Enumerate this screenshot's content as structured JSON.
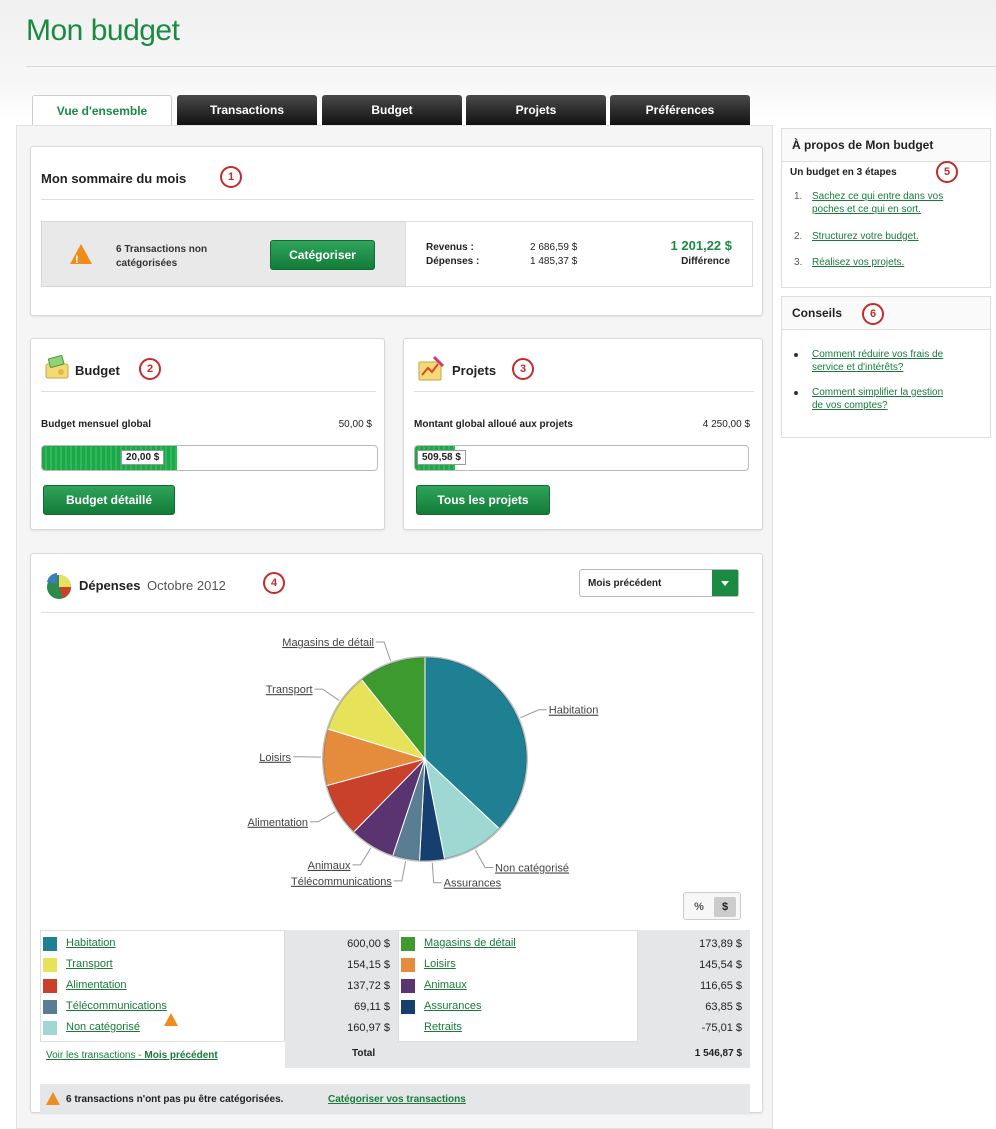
{
  "page": {
    "title": "Mon budget"
  },
  "tabs": [
    {
      "label": "Vue d'ensemble",
      "active": true
    },
    {
      "label": "Transactions",
      "active": false
    },
    {
      "label": "Budget",
      "active": false
    },
    {
      "label": "Projets",
      "active": false
    },
    {
      "label": "Préférences",
      "active": false
    }
  ],
  "summary": {
    "title": "Mon sommaire du mois",
    "badge": "1",
    "uncat_text_1": "6 Transactions non",
    "uncat_text_2": "catégorisées",
    "categorize_button": "Catégoriser",
    "revenues_label": "Revenus :",
    "revenues_value": "2 686,59 $",
    "expenses_label": "Dépenses :",
    "expenses_value": "1 485,37 $",
    "difference_value": "1 201,22 $",
    "difference_label": "Différence"
  },
  "budget": {
    "title": "Budget",
    "badge": "2",
    "label": "Budget mensuel global",
    "total": "50,00 $",
    "bar_value": "20,00 $",
    "bar_fraction": 0.4,
    "button": "Budget détaillé"
  },
  "projects": {
    "title": "Projets",
    "badge": "3",
    "label": "Montant global alloué aux projets",
    "total": "4 250,00 $",
    "bar_value": "509,58 $",
    "bar_fraction": 0.12,
    "button": "Tous les projets"
  },
  "expenses": {
    "title": "Dépenses",
    "period": "Octobre 2012",
    "badge": "4",
    "dropdown_value": "Mois précédent",
    "toggle_percent": "%",
    "toggle_dollar": "$",
    "total_label": "Total",
    "total_value": "1 546,87 $",
    "view_link_prefix": "Voir les transactions - ",
    "view_link_bold": "Mois précédent",
    "alert_text": "6 transactions n'ont pas pu être catégorisées.",
    "alert_link": "Catégoriser vos transactions"
  },
  "chart_data": {
    "type": "pie",
    "slices": [
      {
        "name": "Habitation",
        "value": 600.0,
        "display": "600,00 $",
        "color": "#1f7f93"
      },
      {
        "name": "Non catégorisé",
        "value": 160.97,
        "display": "160,97 $",
        "color": "#9fd8d2"
      },
      {
        "name": "Assurances",
        "value": 63.85,
        "display": "63,85 $",
        "color": "#143f6e"
      },
      {
        "name": "Télécommunications",
        "value": 69.11,
        "display": "69,11 $",
        "color": "#5b7d94"
      },
      {
        "name": "Animaux",
        "value": 116.65,
        "display": "116,65 $",
        "color": "#5a3470"
      },
      {
        "name": "Alimentation",
        "value": 137.72,
        "display": "137,72 $",
        "color": "#c9412b"
      },
      {
        "name": "Loisirs",
        "value": 145.54,
        "display": "145,54 $",
        "color": "#e58b3c"
      },
      {
        "name": "Transport",
        "value": 154.15,
        "display": "154,15 $",
        "color": "#e6e35a"
      },
      {
        "name": "Magasins de détail",
        "value": 173.89,
        "display": "173,89 $",
        "color": "#3c9a2e"
      }
    ],
    "retraits": {
      "name": "Retraits",
      "display": "-75,01 $"
    }
  },
  "legend": {
    "left": [
      {
        "name": "Habitation",
        "value": "600,00 $",
        "color": "#1f7f93"
      },
      {
        "name": "Transport",
        "value": "154,15 $",
        "color": "#e6e35a"
      },
      {
        "name": "Alimentation",
        "value": "137,72 $",
        "color": "#c9412b"
      },
      {
        "name": "Télécommunications",
        "value": "69,11 $",
        "color": "#5b7d94"
      },
      {
        "name": "Non catégorisé",
        "value": "160,97 $",
        "color": "#9fd8d2"
      }
    ],
    "right": [
      {
        "name": "Magasins de détail",
        "value": "173,89 $",
        "color": "#3c9a2e"
      },
      {
        "name": "Loisirs",
        "value": "145,54 $",
        "color": "#e58b3c"
      },
      {
        "name": "Animaux",
        "value": "116,65 $",
        "color": "#5a3470"
      },
      {
        "name": "Assurances",
        "value": "63,85 $",
        "color": "#143f6e"
      },
      {
        "name": "Retraits",
        "value": "-75,01 $",
        "color": ""
      }
    ]
  },
  "sidebar": {
    "about_title": "À propos de Mon budget",
    "steps_heading": "Un budget en 3 étapes",
    "badge_5": "5",
    "steps": [
      {
        "num": "1.",
        "line1": "Sachez ce qui entre dans vos",
        "line2": "poches et ce qui en sort."
      },
      {
        "num": "2.",
        "line1": "Structurez votre budget.",
        "line2": ""
      },
      {
        "num": "3.",
        "line1": "Réalisez vos projets.",
        "line2": ""
      }
    ],
    "tips_title": "Conseils",
    "badge_6": "6",
    "tips": [
      {
        "line1": "Comment réduire vos frais de",
        "line2": "service et d'intérêts?"
      },
      {
        "line1": "Comment simplifier la gestion",
        "line2": "de vos comptes?"
      }
    ]
  },
  "colors": {
    "brand_green": "#1b8a43",
    "badge_red": "#c42b2b",
    "warning_orange": "#f08c1e"
  }
}
